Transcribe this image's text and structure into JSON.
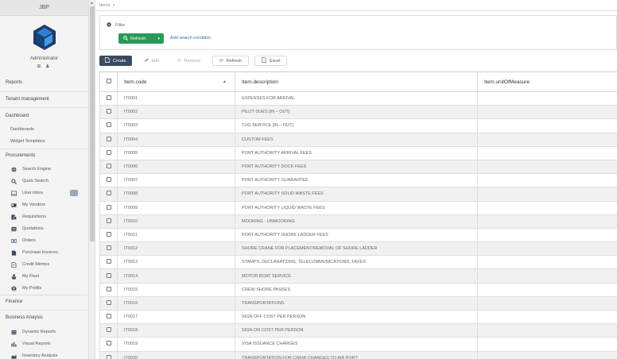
{
  "sidebar": {
    "app_name": "JBP",
    "user_name": "Administrator",
    "user_icons": "⊞ ♟",
    "sections": {
      "reports": "Reports",
      "tenant": "Tenant management",
      "dashboard": "Dashboard",
      "procurements": "Procurements",
      "finance": "Finance",
      "business": "Business Anaysis"
    },
    "dashboard_items": [
      "Dashboards",
      "Widget Templates"
    ],
    "procurement_items": [
      "Search Engine",
      "Quick Search",
      "User inbox",
      "My Vendors",
      "Requisitions",
      "Quotations",
      "Orders",
      "Purchase Invoices",
      "Credit Memos",
      "My Fleet",
      "My Profile"
    ],
    "business_items": [
      "Dynamic Reports",
      "Visual Reports",
      "Inventory Analysis"
    ]
  },
  "tabs": {
    "items": "Items",
    "close": "×"
  },
  "filter": {
    "label": "Filter",
    "refresh_label": "Refresh",
    "add_condition": "Add search condition"
  },
  "toolbar": {
    "create": "Create",
    "edit": "Edit",
    "remove": "Remove",
    "refresh": "Refresh",
    "excel": "Excel"
  },
  "table": {
    "columns": [
      "Item.code",
      "Item.description",
      "Item.unitOfMeasure"
    ],
    "rows": [
      [
        "IT0001",
        "EXPENSES FOR ARRIVAL",
        ""
      ],
      [
        "IT0002",
        "PILOT DUES [IN – OUT]",
        ""
      ],
      [
        "IT0003",
        "TUG SERVICE [IN – OUT]",
        ""
      ],
      [
        "IT0004",
        "CUSTOM FEES",
        ""
      ],
      [
        "IT0005",
        "PORT AUTHORITY ARRIVAL FEES",
        ""
      ],
      [
        "IT0006",
        "PORT AUTHORITY DOCK FEES",
        ""
      ],
      [
        "IT0007",
        "PORT AUTHORITY GUARANTEE",
        ""
      ],
      [
        "IT0008",
        "PORT AUTHORITY SOLID WASTE FEES",
        ""
      ],
      [
        "IT0009",
        "PORT AUTHORITY LIQUID WASTE FEES",
        ""
      ],
      [
        "IT0010",
        "MOORING - UNMOORING",
        ""
      ],
      [
        "IT0011",
        "PORT AUTHORITY SHORE LADDER FEES",
        ""
      ],
      [
        "IT0012",
        "SHORE CRANE FOR PLACEMENT/REMOVAL OF SHORE LADDER",
        ""
      ],
      [
        "IT0013",
        "STAMPS, DECLARATIONS, TELECOMMUNICATIONS, FAXES",
        ""
      ],
      [
        "IT0014",
        "MOTOR BOAT SERVICE",
        ""
      ],
      [
        "IT0015",
        "CREW SHORE PASSES",
        ""
      ],
      [
        "IT0016",
        "TRANSPORTATIONS",
        ""
      ],
      [
        "IT0017",
        "SIGN OFF COST PER PERSON",
        ""
      ],
      [
        "IT0018",
        "SIGN ON COST PER PERSON",
        ""
      ],
      [
        "IT0019",
        "VISA ISSUANCE CHARGES",
        ""
      ],
      [
        "IT0020",
        "TRANSPORTATION FOR CREW CHANGES TO AIR PORT",
        ""
      ]
    ]
  },
  "colors": {
    "accent_green": "#2a9a57",
    "create_button": "#3b4a63",
    "link_blue": "#3a6ea5"
  }
}
